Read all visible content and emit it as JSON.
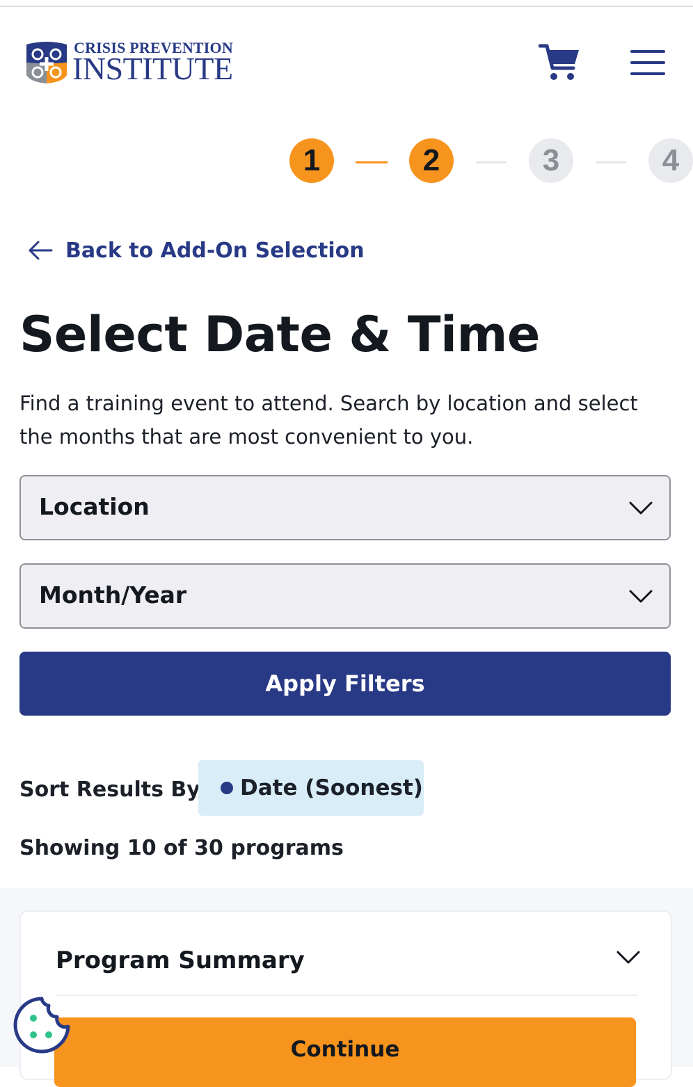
{
  "header": {
    "logo_top": "CRISIS PREVENTION",
    "logo_bottom": "INSTITUTE",
    "cart_icon": "shopping-cart-icon",
    "menu_icon": "hamburger-menu-icon"
  },
  "stepper": {
    "current_step": 2,
    "steps": [
      {
        "number": "1",
        "state": "complete"
      },
      {
        "number": "2",
        "state": "active"
      },
      {
        "number": "3",
        "state": "upcoming"
      },
      {
        "number": "4",
        "state": "upcoming"
      }
    ]
  },
  "back_link": {
    "label": "Back to Add-On Selection",
    "icon": "arrow-left-icon"
  },
  "page": {
    "title": "Select Date & Time",
    "intro": "Find a training event to attend. Search by location and select the months that are most convenient to you."
  },
  "filters": {
    "location_label": "Location",
    "month_year_label": "Month/Year",
    "apply_label": "Apply Filters"
  },
  "sort": {
    "label": "Sort Results By:",
    "selected": "Date (Soonest)"
  },
  "results": {
    "showing_text": "Showing 10 of 30 programs"
  },
  "summary": {
    "title": "Program Summary",
    "continue_label": "Continue"
  },
  "colors": {
    "brand_navy": "#283a86",
    "accent_orange": "#f7941d",
    "chip_blue": "#d8edf8",
    "inactive_step": "#e9eaee"
  },
  "cookie_icon": "cookie-icon"
}
